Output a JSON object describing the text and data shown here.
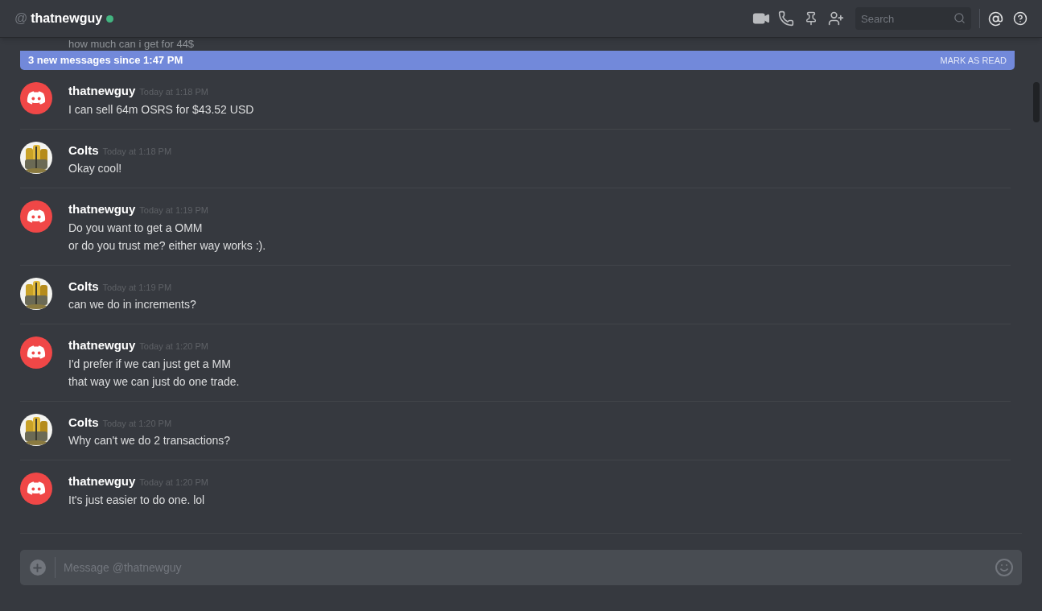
{
  "header": {
    "at": "@",
    "username": "thatnewguy",
    "online": true,
    "search_placeholder": "Search"
  },
  "banner": {
    "text": "3 new messages since 1:47 PM",
    "action": "MARK AS READ"
  },
  "faded_message": "how much can i get for 44$",
  "messages": [
    {
      "author": "thatnewguy",
      "kind": "logo",
      "time": "Today at 1:18 PM",
      "lines": [
        "I can sell 64m OSRS for $43.52 USD"
      ]
    },
    {
      "author": "Colts",
      "kind": "picture",
      "time": "Today at 1:18 PM",
      "lines": [
        "Okay cool!"
      ]
    },
    {
      "author": "thatnewguy",
      "kind": "logo",
      "time": "Today at 1:19 PM",
      "lines": [
        "Do you want to get a OMM",
        "or do you trust me? either way works :)."
      ]
    },
    {
      "author": "Colts",
      "kind": "picture",
      "time": "Today at 1:19 PM",
      "lines": [
        "can we do in increments?"
      ]
    },
    {
      "author": "thatnewguy",
      "kind": "logo",
      "time": "Today at 1:20 PM",
      "lines": [
        "I'd prefer if we can just get a MM",
        "that way we can just do one trade."
      ]
    },
    {
      "author": "Colts",
      "kind": "picture",
      "time": "Today at 1:20 PM",
      "lines": [
        "Why can't we do 2 transactions?"
      ]
    },
    {
      "author": "thatnewguy",
      "kind": "logo",
      "time": "Today at 1:20 PM",
      "lines": [
        "It's just easier to do one. lol"
      ]
    }
  ],
  "composer": {
    "placeholder": "Message @thatnewguy"
  }
}
